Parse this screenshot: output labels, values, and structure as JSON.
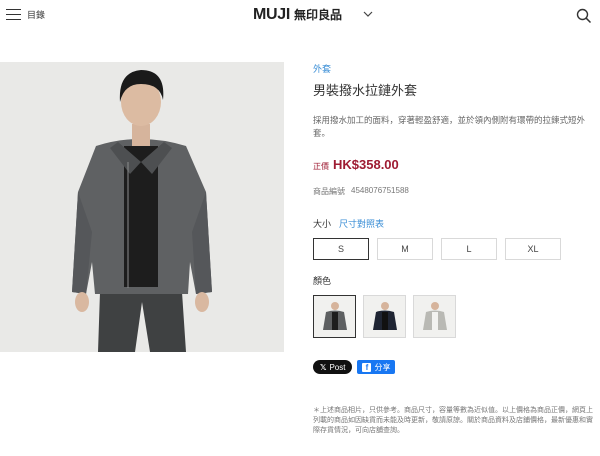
{
  "header": {
    "menu_label": "目錄",
    "logo_en": "MUJI",
    "logo_ja": "無印良品"
  },
  "product": {
    "category": "外套",
    "title": "男裝撥水拉鏈外套",
    "description": "採用撥水加工的面料，穿著輕盈舒適，並於領內側附有環帶的拉鍊式短外套。",
    "price_tag": "正價",
    "price": "HK$358.00",
    "sku_label": "商品編號",
    "sku": "4548076751588"
  },
  "size": {
    "label": "大小",
    "chart_link": "尺寸對照表",
    "options": [
      "S",
      "M",
      "L",
      "XL"
    ],
    "selected": "S"
  },
  "color": {
    "label": "顏色",
    "swatches": [
      {
        "name": "gray",
        "color": "#5e6062"
      },
      {
        "name": "navy",
        "color": "#1f2533"
      },
      {
        "name": "light-gray",
        "color": "#b9b9b4"
      }
    ]
  },
  "share": {
    "x_label": "Post",
    "fb_label": "分享"
  },
  "note": "＊上述商品相片，只供參考。商品尺寸，容量等數為近似值。以上價格為商品正價，網頁上列載的商品如因缺貨而未能及時更新，敬請原諒。關於商品資料及店鋪價格，最新優惠和實際存貨情況，可向店舖查詢。",
  "colors": {
    "accent_blue": "#3a8ed6",
    "price_red": "#9e1b32"
  }
}
